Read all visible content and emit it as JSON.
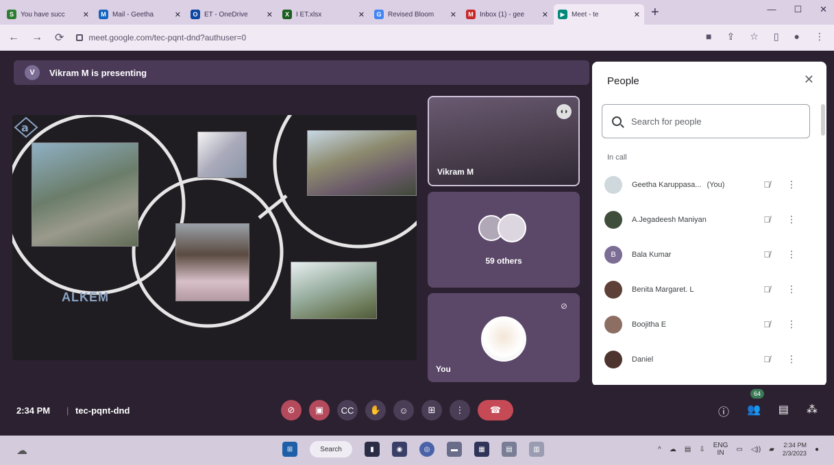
{
  "browser": {
    "tabs": [
      {
        "label": "You have succ",
        "fav": "S",
        "color": "#2e7d32"
      },
      {
        "label": "Mail - Geetha",
        "fav": "M",
        "color": "#1565c0"
      },
      {
        "label": "ET - OneDrive",
        "fav": "O",
        "color": "#0d47a1"
      },
      {
        "label": "I ET.xlsx",
        "fav": "X",
        "color": "#1b5e20"
      },
      {
        "label": "Revised Bloom",
        "fav": "G",
        "color": "#4285f4"
      },
      {
        "label": "Inbox (1) - gee",
        "fav": "M",
        "color": "#c62828"
      },
      {
        "label": "Meet - te",
        "fav": "▶",
        "color": "#00897b"
      }
    ],
    "new_tab": "+",
    "url": "meet.google.com/tec-pqnt-dnd?authuser=0"
  },
  "meet": {
    "presenting_initial": "V",
    "presenting_text": "Vikram M is presenting",
    "slide_logo_text": "ALKEM",
    "tiles": {
      "speaker_name": "Vikram M",
      "others_label": "59 others",
      "self_label": "You"
    },
    "people_panel": {
      "title": "People",
      "search_placeholder": "Search for people",
      "section_label": "In call",
      "participants": [
        {
          "name": "Geetha Karuppasa...",
          "tag": "(You)",
          "initial": "",
          "color": "#cfd8dc"
        },
        {
          "name": "A.Jegadeesh Maniyan",
          "tag": "",
          "initial": "",
          "color": "#3e4e3a"
        },
        {
          "name": "Bala Kumar",
          "tag": "",
          "initial": "B",
          "color": "#7c6d94"
        },
        {
          "name": "Benita Margaret. L",
          "tag": "",
          "initial": "",
          "color": "#5d4037"
        },
        {
          "name": "Boojitha E",
          "tag": "",
          "initial": "",
          "color": "#8d6e63"
        },
        {
          "name": "Daniel",
          "tag": "",
          "initial": "",
          "color": "#4e342e"
        }
      ]
    },
    "bottom": {
      "time": "2:34 PM",
      "separator": "|",
      "meeting_code": "tec-pqnt-dnd",
      "people_count": "64"
    }
  },
  "taskbar": {
    "search_label": "Search",
    "lang": "ENG",
    "lang_sub": "IN",
    "time": "2:34 PM",
    "date": "2/3/2023"
  }
}
